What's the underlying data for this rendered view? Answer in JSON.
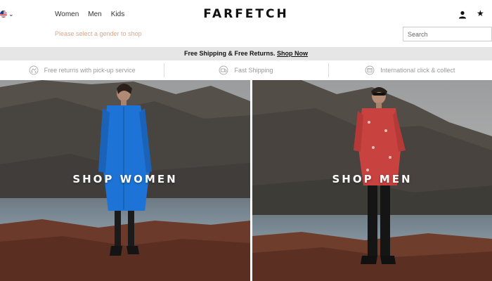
{
  "header": {
    "logo": "FARFETCH",
    "nav": [
      {
        "label": "Women"
      },
      {
        "label": "Men"
      },
      {
        "label": "Kids"
      }
    ],
    "gender_hint": "Please select a gender to shop",
    "search_placeholder": "Search",
    "icons": {
      "locale": "us-flag-icon",
      "account": "user-icon",
      "wishlist": "star-icon"
    }
  },
  "promo": {
    "text": "Free Shipping & Free Returns. ",
    "link": "Shop Now"
  },
  "benefits": [
    {
      "label": "Free returns with pick-up service",
      "icon": "pickup-icon"
    },
    {
      "label": "Fast Shipping",
      "icon": "shipping-icon"
    },
    {
      "label": "International click & collect",
      "icon": "click-collect-icon"
    }
  ],
  "heroes": {
    "women": {
      "label": "SHOP WOMEN"
    },
    "men": {
      "label": "SHOP MEN"
    }
  },
  "colors": {
    "accent_hint": "#d9a98c",
    "promo_bg": "#e6e6e6",
    "women_dress": "#1e73d6",
    "men_shirt": "#c8423f"
  }
}
